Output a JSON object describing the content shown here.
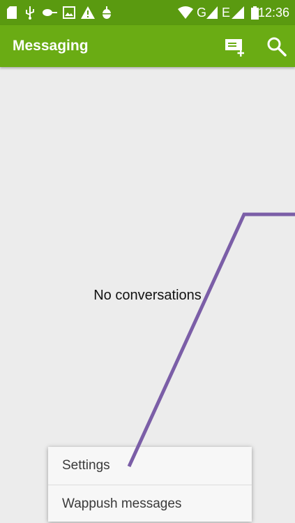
{
  "status_bar": {
    "time": "12:36",
    "network_text": "G",
    "network_text_2": "E",
    "icons": [
      "sd-card-icon",
      "usb-icon",
      "battery-saver-icon",
      "image-icon",
      "warning-icon",
      "android-debug-icon",
      "wifi-icon",
      "signal-icon",
      "signal-icon",
      "battery-icon"
    ]
  },
  "app_bar": {
    "title": "Messaging",
    "actions": [
      "new-message-icon",
      "search-icon"
    ],
    "color": "#6aac14"
  },
  "main": {
    "empty_text": "No conversations"
  },
  "overflow_menu": {
    "items": [
      {
        "label": "Settings"
      },
      {
        "label": "Wappush messages"
      }
    ]
  },
  "annotation": {
    "color": "#7b5ea7"
  }
}
